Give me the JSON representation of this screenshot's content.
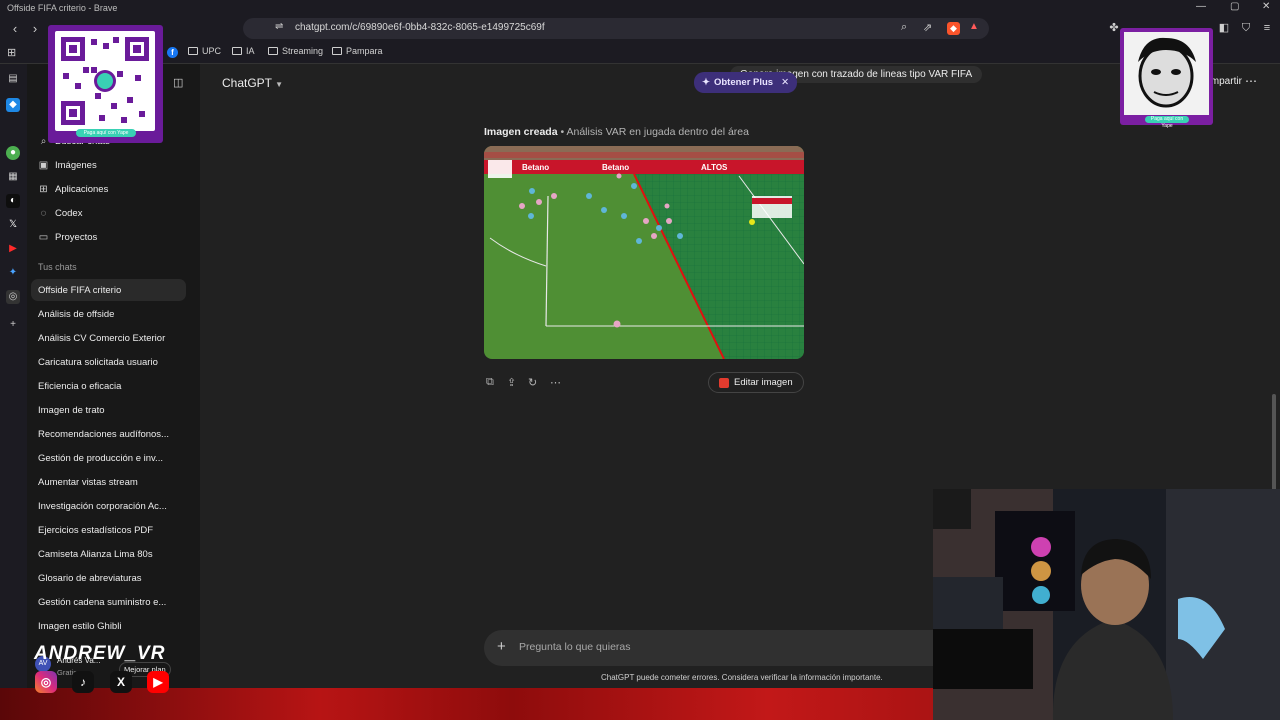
{
  "window": {
    "title": "Offside FIFA criterio - Brave"
  },
  "browser": {
    "url": "chatgpt.com/c/69890e6f-0bb4-832c-8065-e1499725c69f",
    "bookmarks": [
      {
        "label": "UPC",
        "icon": "folder-icon"
      },
      {
        "label": "IA",
        "icon": "folder-icon"
      },
      {
        "label": "Streaming",
        "icon": "folder-icon"
      },
      {
        "label": "Pampara",
        "icon": "folder-icon"
      }
    ]
  },
  "sidebar": {
    "nav": [
      {
        "label": "Buscar chats",
        "icon": "search-icon"
      },
      {
        "label": "Imágenes",
        "icon": "image-icon"
      },
      {
        "label": "Aplicaciones",
        "icon": "apps-icon"
      },
      {
        "label": "Codex",
        "icon": "codex-icon"
      },
      {
        "label": "Proyectos",
        "icon": "folder-icon"
      }
    ],
    "section_label": "Tus chats",
    "chats": [
      "Offside FIFA criterio",
      "Análisis de offside",
      "Análisis CV Comercio Exterior",
      "Caricatura solicitada usuario",
      "Eficiencia o eficacia",
      "Imagen de trato",
      "Recomendaciones audífonos...",
      "Gestión de producción e inv...",
      "Aumentar vistas stream",
      "Investigación corporación Ac...",
      "Ejercicios estadísticos PDF",
      "Camiseta Alianza Lima 80s",
      "Glosario de abreviaturas",
      "Gestión cadena suministro e...",
      "Imagen estilo Ghibli"
    ],
    "user": {
      "name": "Andrés Va...",
      "plan": "Gratis",
      "upgrade": "Mejorar plan"
    }
  },
  "main": {
    "model": "ChatGPT",
    "upgrade_pill": "Obtener Plus",
    "user_message": "Genera imagen con trazado de lineas tipo VAR FIFA",
    "share": "Compartir",
    "caption_bold": "Imagen creada",
    "caption_rest": " • Análisis VAR en jugada dentro del área",
    "ad_boards": [
      "Betano",
      "Betano",
      "ALTOS"
    ],
    "edit_button": "Editar imagen",
    "composer_placeholder": "Pregunta lo que quieras",
    "disclaimer": "ChatGPT puede cometer errores. Considera verificar la información importante."
  },
  "overlay": {
    "qr_label": "Paga aquí con Yape",
    "handle": "ANDREW_VR",
    "socials": [
      "instagram-icon",
      "tiktok-icon",
      "x-icon",
      "youtube-icon"
    ]
  },
  "colors": {
    "purple_pill": "#3d2f7a",
    "yape": "#6a1b9a",
    "brand_red": "#b71414",
    "offside_line": "#e01010"
  }
}
